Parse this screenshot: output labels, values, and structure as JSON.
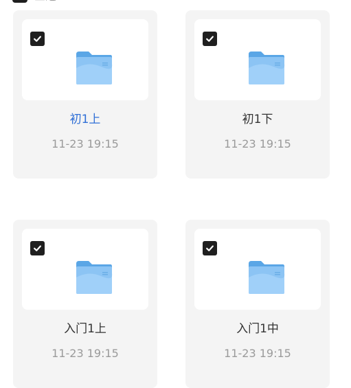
{
  "header": {
    "select_all_label": "全选"
  },
  "colors": {
    "active_name": "#2f6fd6",
    "default_name": "#333333",
    "timestamp": "#9a9a9a",
    "card_bg": "#f4f4f4",
    "checkbox": "#1f1f1f"
  },
  "folders": [
    {
      "name": "初1上",
      "time": "11-23 19:15",
      "checked": true,
      "highlighted": true
    },
    {
      "name": "初1下",
      "time": "11-23 19:15",
      "checked": true,
      "highlighted": false
    },
    {
      "name": "入门1上",
      "time": "11-23 19:15",
      "checked": true,
      "highlighted": false
    },
    {
      "name": "入门1中",
      "time": "11-23 19:15",
      "checked": true,
      "highlighted": false
    }
  ]
}
